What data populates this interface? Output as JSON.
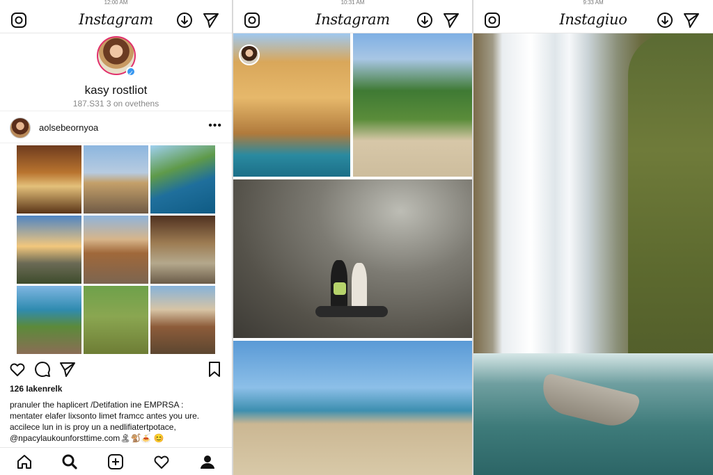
{
  "panel1": {
    "status": "12:00 AM",
    "app_title": "Instagram",
    "profile": {
      "name": "kasy rostliot",
      "stats": "187.S31 3 on ovethens"
    },
    "post": {
      "username": "aolsebeornyoa",
      "likes": "126 Iakenrelk",
      "caption_lines": [
        "pranuler the haplicert /Detifation ine EMPRSA :",
        "mentater elafer lixsonto limet framcc antes you ure.",
        "accilece lun in is proy un a nedlifiatertpotace,",
        "@npacylaukounforsttime.com🏝🐒🍝 😊"
      ]
    },
    "icons": {
      "camera": "camera-icon",
      "download": "download-icon",
      "direct": "direct-message-icon",
      "like": "heart-icon",
      "comment": "comment-icon",
      "share": "share-icon",
      "save": "bookmark-icon",
      "home": "home-icon",
      "search": "search-icon",
      "add": "add-post-icon",
      "activity": "heart-icon",
      "profile": "profile-icon"
    }
  },
  "panel2": {
    "status": "10:31 AM",
    "app_title": "Instagram"
  },
  "panel3": {
    "status": "9:33 AM",
    "app_title": "Instagiuo"
  },
  "colors": {
    "verified": "#3897f0",
    "story_ring": "#e1306c"
  }
}
